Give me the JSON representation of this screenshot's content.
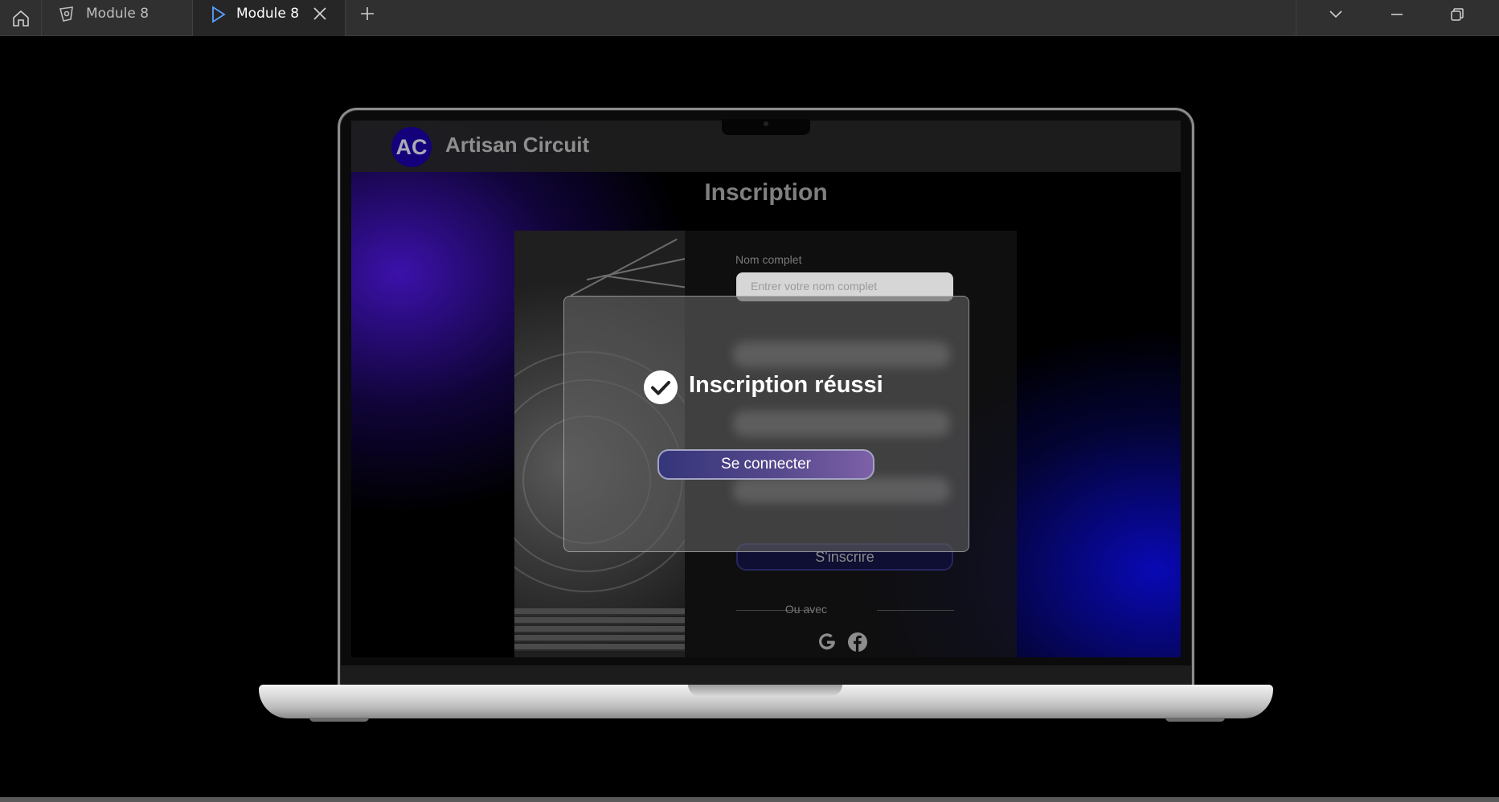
{
  "tabbar": {
    "tabs": [
      {
        "label": "Module 8",
        "icon": "design-icon",
        "active": false
      },
      {
        "label": "Module 8",
        "icon": "play-icon",
        "active": true
      }
    ]
  },
  "site": {
    "logo_text": "AC",
    "brand": "Artisan Circuit",
    "page_title": "Inscription"
  },
  "form": {
    "name_label": "Nom complet",
    "name_placeholder": "Entrer votre nom complet",
    "submit_label": "S'inscrire",
    "or_text": "Ou avec",
    "social": [
      "google-icon",
      "facebook-icon"
    ]
  },
  "modal": {
    "title": "Inscription réussi",
    "button_label": "Se connecter"
  },
  "colors": {
    "accent_gradient_start": "#35357a",
    "accent_gradient_end": "#7d61a8",
    "logo_bg": "#13007a"
  }
}
